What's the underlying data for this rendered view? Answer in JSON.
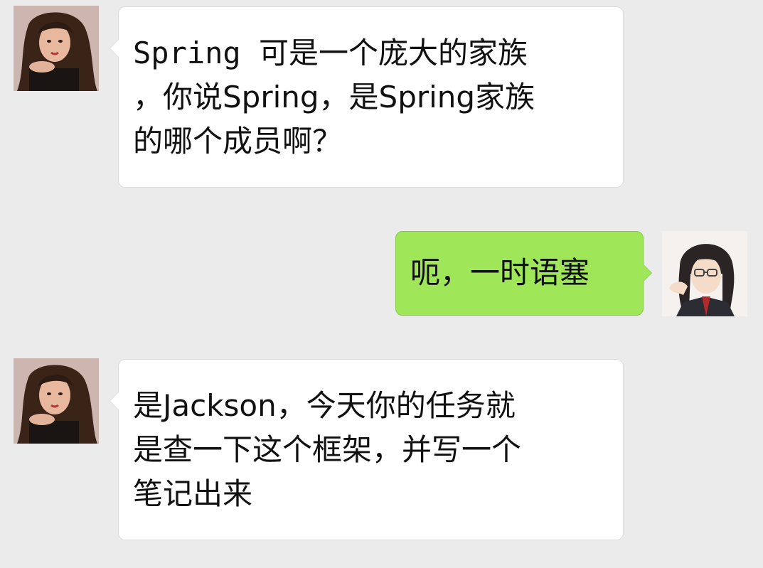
{
  "chat": {
    "messages": [
      {
        "sender": "other",
        "lines": [
          "Spring 可是一个庞大的家族",
          "，你说Spring，是Spring家族",
          "的哪个成员啊？"
        ]
      },
      {
        "sender": "self",
        "lines": [
          "呃，一时语塞"
        ]
      },
      {
        "sender": "other",
        "lines": [
          "是Jackson，今天你的任务就",
          "是查一下这个框架，并写一个",
          "笔记出来"
        ]
      }
    ]
  },
  "colors": {
    "background": "#ebebeb",
    "incoming_bubble": "#ffffff",
    "outgoing_bubble": "#9fe658"
  },
  "icons": {
    "other_avatar": "avatar-woman-long-hair",
    "self_avatar": "avatar-man-glasses"
  }
}
